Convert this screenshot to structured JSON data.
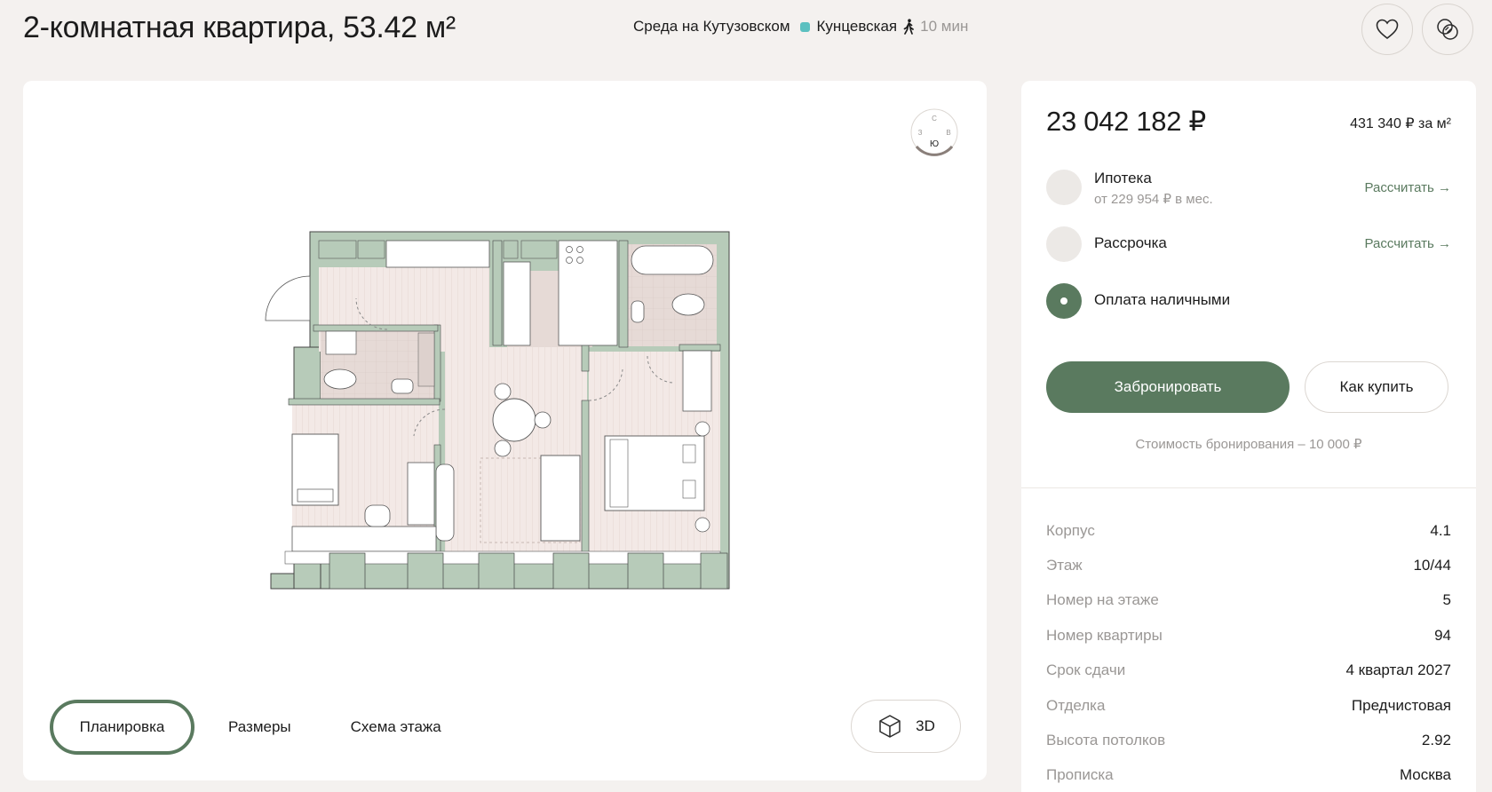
{
  "header": {
    "title": "2-комнатная квартира, 53.42 м²",
    "complex": "Среда на Кутузовском",
    "metro": "Кунцевская",
    "walk_time": "10 мин",
    "metro_color": "#5cc0c0",
    "favorite_icon": "heart-icon",
    "compare_icon": "compare-icon"
  },
  "plan": {
    "compass": {
      "north": "С",
      "west": "З",
      "east": "В",
      "south": "Ю"
    },
    "tabs": [
      {
        "label": "Планировка",
        "active": true
      },
      {
        "label": "Размеры",
        "active": false
      },
      {
        "label": "Схема этажа",
        "active": false
      }
    ],
    "view_3d_label": "3D",
    "wall_color": "#b7cbb9",
    "floor_color": "#f1e7e4"
  },
  "pricing": {
    "price": "23 042 182 ₽",
    "price_per_m2": "431 340 ₽ за м²",
    "options": [
      {
        "label": "Ипотека",
        "sub": "от 229 954 ₽ в мес.",
        "link": "Рассчитать →",
        "selected": false
      },
      {
        "label": "Рассрочка",
        "sub": "",
        "link": "Рассчитать →",
        "selected": false
      },
      {
        "label": "Оплата наличными",
        "sub": "",
        "link": "",
        "selected": true
      }
    ],
    "book_button": "Забронировать",
    "how_to_buy_button": "Как купить",
    "booking_note": "Стоимость бронирования – 10 000 ₽",
    "accent_color": "#5a7a5f"
  },
  "properties": [
    {
      "key": "Корпус",
      "value": "4.1"
    },
    {
      "key": "Этаж",
      "value": "10/44"
    },
    {
      "key": "Номер на этаже",
      "value": "5"
    },
    {
      "key": "Номер квартиры",
      "value": "94"
    },
    {
      "key": "Срок сдачи",
      "value": "4 квартал 2027"
    },
    {
      "key": "Отделка",
      "value": "Предчистовая"
    },
    {
      "key": "Высота потолков",
      "value": "2.92"
    },
    {
      "key": "Прописка",
      "value": "Москва"
    }
  ]
}
